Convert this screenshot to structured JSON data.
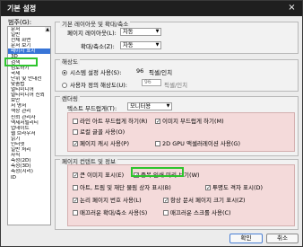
{
  "window": {
    "title": "기본 설정",
    "close": "×"
  },
  "category_label": "범주(G):",
  "categories": [
    "문서",
    "일반",
    "전체 화면",
    "문서 보기",
    "페이지 표시",
    "3D",
    "검색",
    "검토하기",
    "국제",
    "단위 및 안내선",
    "맞춤법",
    "멀티미디어",
    "멀티미디어 신뢰",
    "보안",
    "서 명서",
    "색상 관리",
    "신뢰 관리자",
    "액세서빌리티",
    "업데이트",
    "웹 브라우저",
    "읽기",
    "인터넷",
    "일반 처리",
    "자식",
    "측정(2D)",
    "측정(3D)",
    "측정(지리)",
    "ID"
  ],
  "selected_category": "페이지 표시",
  "layout": {
    "title": "기본 레이아웃 및 확대/축소",
    "page_layout_label": "페이지 레이아웃(L):",
    "page_layout_value": "자동",
    "zoom_label": "확대/축소(Z):",
    "zoom_value": "자동"
  },
  "resolution": {
    "title": "해상도",
    "system_label": "시스템 설정 사용(S):",
    "system_value": "96",
    "system_unit": "픽셀/인치",
    "custom_label": "사용자 정의 해상도(U):",
    "custom_value": "96",
    "custom_unit": "픽셀/인치"
  },
  "rendering": {
    "title": "렌더링",
    "smooth_text_label": "텍스트 부드럽게(T):",
    "smooth_text_value": "모니터용",
    "opts": [
      {
        "label": "라인 아트 부드럽게 하기(R)",
        "checked": false
      },
      {
        "label": "이미지 부드럽게 하기(M)",
        "checked": true
      },
      {
        "label": "로컬 글꼴 사용(O)",
        "checked": false
      },
      {
        "label": "페이지 캐시 사용(P)",
        "checked": true
      },
      {
        "label": "2D GPU 액셀러레이션 사용(G)",
        "checked": false
      }
    ]
  },
  "content": {
    "title": "페이지 컨텐트 및 정보",
    "opts": [
      {
        "label": "큰 이미지 표시(E)",
        "checked": true
      },
      {
        "label": "중복 인쇄 미리 보기(W)",
        "checked": true
      },
      {
        "label": "아트, 트림 및 재단 물림 상자 표시(B)",
        "checked": false
      },
      {
        "label": "투명도 격자 표시(D)",
        "checked": true
      },
      {
        "label": "논리 페이지 번호 사용(L)",
        "checked": true
      },
      {
        "label": "항상 문서 페이지 크기 표시(Z)",
        "checked": true
      },
      {
        "label": "매끄러운 확대/축소 사용(S)",
        "checked": false
      },
      {
        "label": "매끄러운 스크롤 사용(C)",
        "checked": false
      }
    ]
  },
  "buttons": {
    "ok": "확인",
    "cancel": "취소"
  },
  "colors": {
    "highlight_green": "#2ec42e",
    "pink_bg": "#f4dada",
    "selection_blue": "#3875d7"
  }
}
